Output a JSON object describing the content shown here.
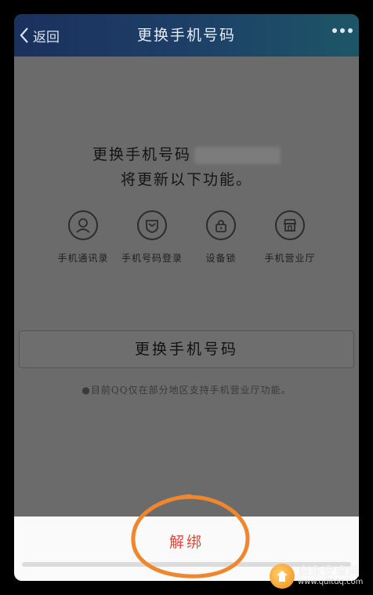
{
  "header": {
    "back_label": "返回",
    "title": "更换手机号码",
    "more_icon": "more-dots-icon"
  },
  "info": {
    "line1": "更换手机号码",
    "line2": "将更新以下功能。"
  },
  "features": [
    {
      "label": "手机通讯录",
      "icon": "contacts-icon"
    },
    {
      "label": "手机号码登录",
      "icon": "phone-login-icon"
    },
    {
      "label": "设备锁",
      "icon": "lock-icon"
    },
    {
      "label": "手机营业厅",
      "icon": "store-icon"
    }
  ],
  "change_button_label": "更换手机号码",
  "note": "●目前QQ仅在部分地区支持手机营业厅功能。",
  "sheet": {
    "unbind_label": "解绑"
  },
  "annotation": {
    "color": "#f0872e"
  },
  "watermark": {
    "title": "启东安卓网",
    "url": "www.qdltdq.com"
  }
}
